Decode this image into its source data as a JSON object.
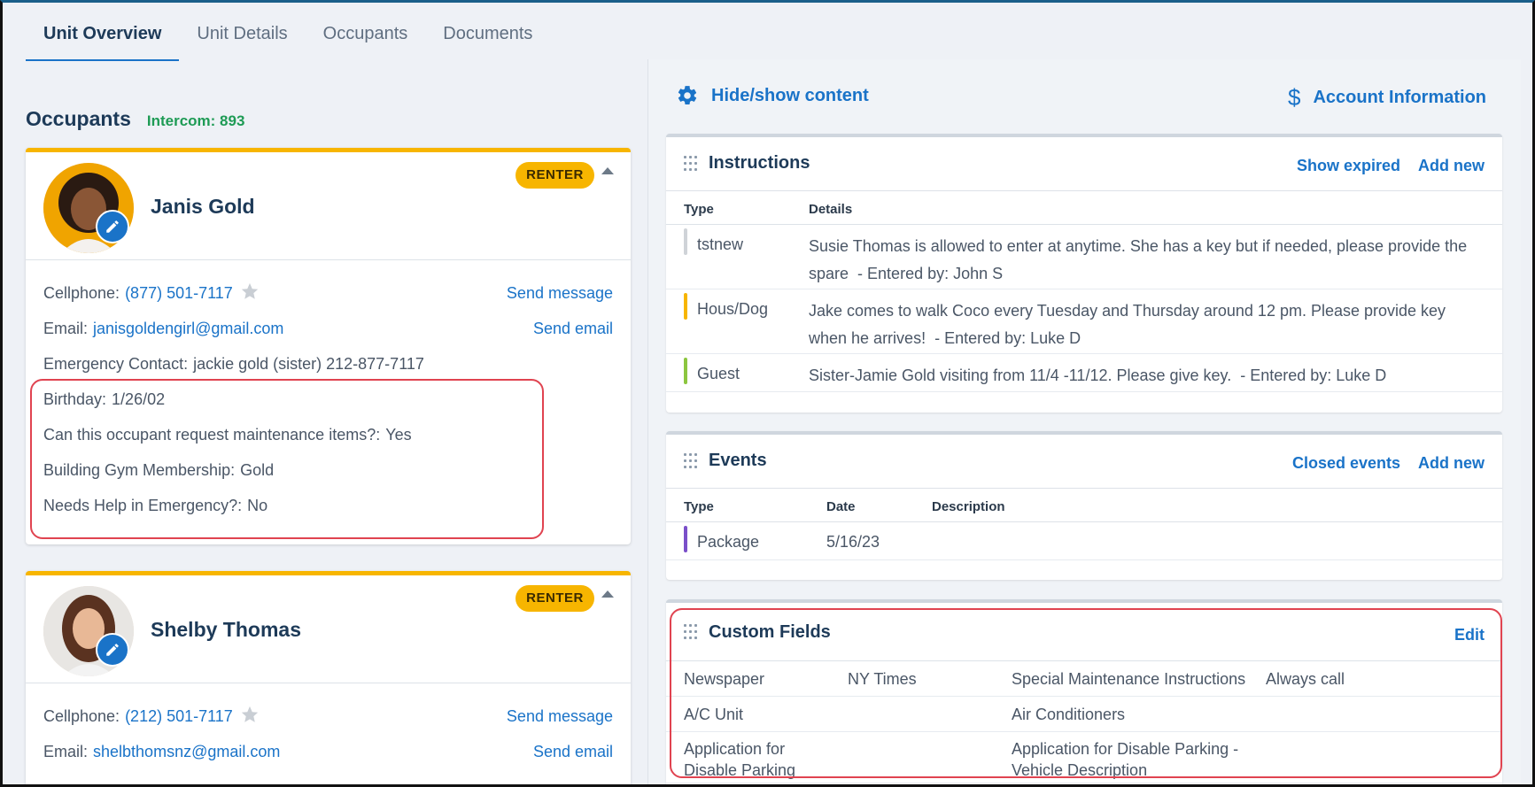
{
  "tabs": [
    {
      "label": "Unit Overview",
      "active": true
    },
    {
      "label": "Unit Details",
      "active": false
    },
    {
      "label": "Occupants",
      "active": false
    },
    {
      "label": "Documents",
      "active": false
    }
  ],
  "occupants_section": {
    "title": "Occupants",
    "intercom": "Intercom: 893"
  },
  "occupants": [
    {
      "name": "Janis Gold",
      "badge": "RENTER",
      "cellphone_label": "Cellphone:",
      "cellphone": "(877) 501-7117",
      "send_message": "Send message",
      "email_label": "Email:",
      "email": "janisgoldengirl@gmail.com",
      "send_email": "Send email",
      "emergency_label": "Emergency Contact:",
      "emergency": "jackie gold (sister) 212-877-7117",
      "birthday_label": "Birthday:",
      "birthday": "1/26/02",
      "maintenance_label": "Can this occupant request maintenance items?:",
      "maintenance": "Yes",
      "gym_label": "Building Gym Membership:",
      "gym": "Gold",
      "help_label": "Needs Help in Emergency?:",
      "help": "No"
    },
    {
      "name": "Shelby Thomas",
      "badge": "RENTER",
      "cellphone_label": "Cellphone:",
      "cellphone": "(212) 501-7117",
      "send_message": "Send message",
      "email_label": "Email:",
      "email": "shelbthomsnz@gmail.com",
      "send_email": "Send email"
    }
  ],
  "top_links": {
    "hide_show": "Hide/show content",
    "account_info": "Account Information"
  },
  "instructions": {
    "title": "Instructions",
    "actions": [
      "Show expired",
      "Add new"
    ],
    "columns": [
      "Type",
      "Details"
    ],
    "rows": [
      {
        "type": "tstnew",
        "color": "#cfd3d8",
        "details": "Susie Thomas is allowed to enter at anytime. She has a key but if needed, please provide the spare",
        "meta": "- Entered by: John S"
      },
      {
        "type": "Hous/Dog",
        "color": "#f7b500",
        "details": "Jake comes to walk Coco every Tuesday and Thursday around 12 pm. Please provide key when he arrives!",
        "meta": "- Entered by: Luke D"
      },
      {
        "type": "Guest",
        "color": "#8cc63f",
        "details": "Sister-Jamie Gold visiting from 11/4 -11/12. Please give key.",
        "meta": "- Entered by: Luke D"
      }
    ]
  },
  "events": {
    "title": "Events",
    "actions": [
      "Closed events",
      "Add new"
    ],
    "columns": [
      "Type",
      "Date",
      "Description"
    ],
    "rows": [
      {
        "type": "Package",
        "date": "5/16/23",
        "description": "",
        "color": "#7a4fc9"
      }
    ]
  },
  "custom_fields": {
    "title": "Custom Fields",
    "edit": "Edit",
    "rows": [
      {
        "label1": "Newspaper",
        "value1": "NY Times",
        "label2": "Special Maintenance Instructions",
        "value2": "Always call"
      },
      {
        "label1": "A/C Unit",
        "value1": "",
        "label2": "Air Conditioners",
        "value2": ""
      },
      {
        "label1": "Application for Disable Parking",
        "value1": "",
        "label2": "Application for Disable Parking - Vehicle Description",
        "value2": ""
      }
    ]
  },
  "colors": {
    "accent": "#1a73c8",
    "renter_badge": "#f7b500",
    "intercom": "#1e9b55",
    "highlight": "#e04350"
  }
}
